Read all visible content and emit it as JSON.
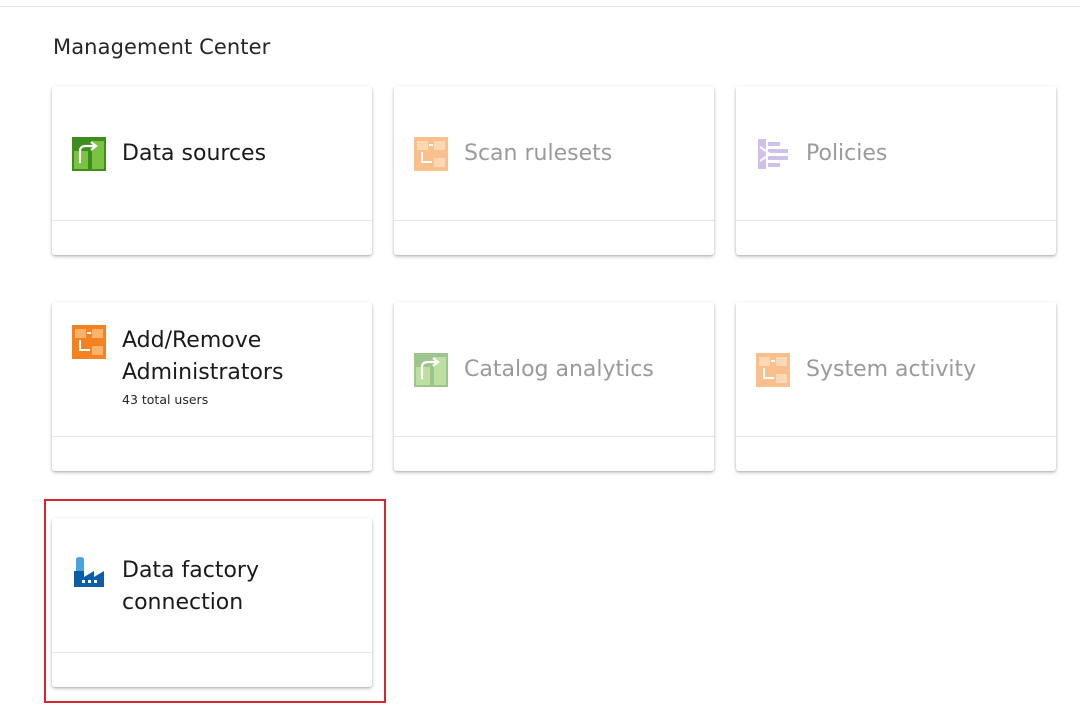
{
  "page": {
    "title": "Management Center"
  },
  "cards": [
    {
      "title": "Data sources",
      "subtitle": "",
      "icon": "data-sources-icon",
      "enabled": true
    },
    {
      "title": "Scan rulesets",
      "subtitle": "",
      "icon": "scan-rulesets-icon",
      "enabled": false
    },
    {
      "title": "Policies",
      "subtitle": "",
      "icon": "policies-icon",
      "enabled": false
    },
    {
      "title": "Add/Remove Administrators",
      "subtitle": "43 total users",
      "icon": "administrators-icon",
      "enabled": true
    },
    {
      "title": "Catalog analytics",
      "subtitle": "",
      "icon": "catalog-analytics-icon",
      "enabled": false
    },
    {
      "title": "System activity",
      "subtitle": "",
      "icon": "system-activity-icon",
      "enabled": false
    },
    {
      "title": "Data factory connection",
      "subtitle": "",
      "icon": "data-factory-icon",
      "enabled": true
    }
  ],
  "colors": {
    "green_dark": "#3e8e1f",
    "green_light": "#7cc242",
    "orange": "#f58220",
    "orange_light": "#fbb36b",
    "purple": "#a27fd8",
    "factory_blue": "#0a5ea8",
    "factory_light": "#4aa3df",
    "highlight": "#d8262e"
  }
}
